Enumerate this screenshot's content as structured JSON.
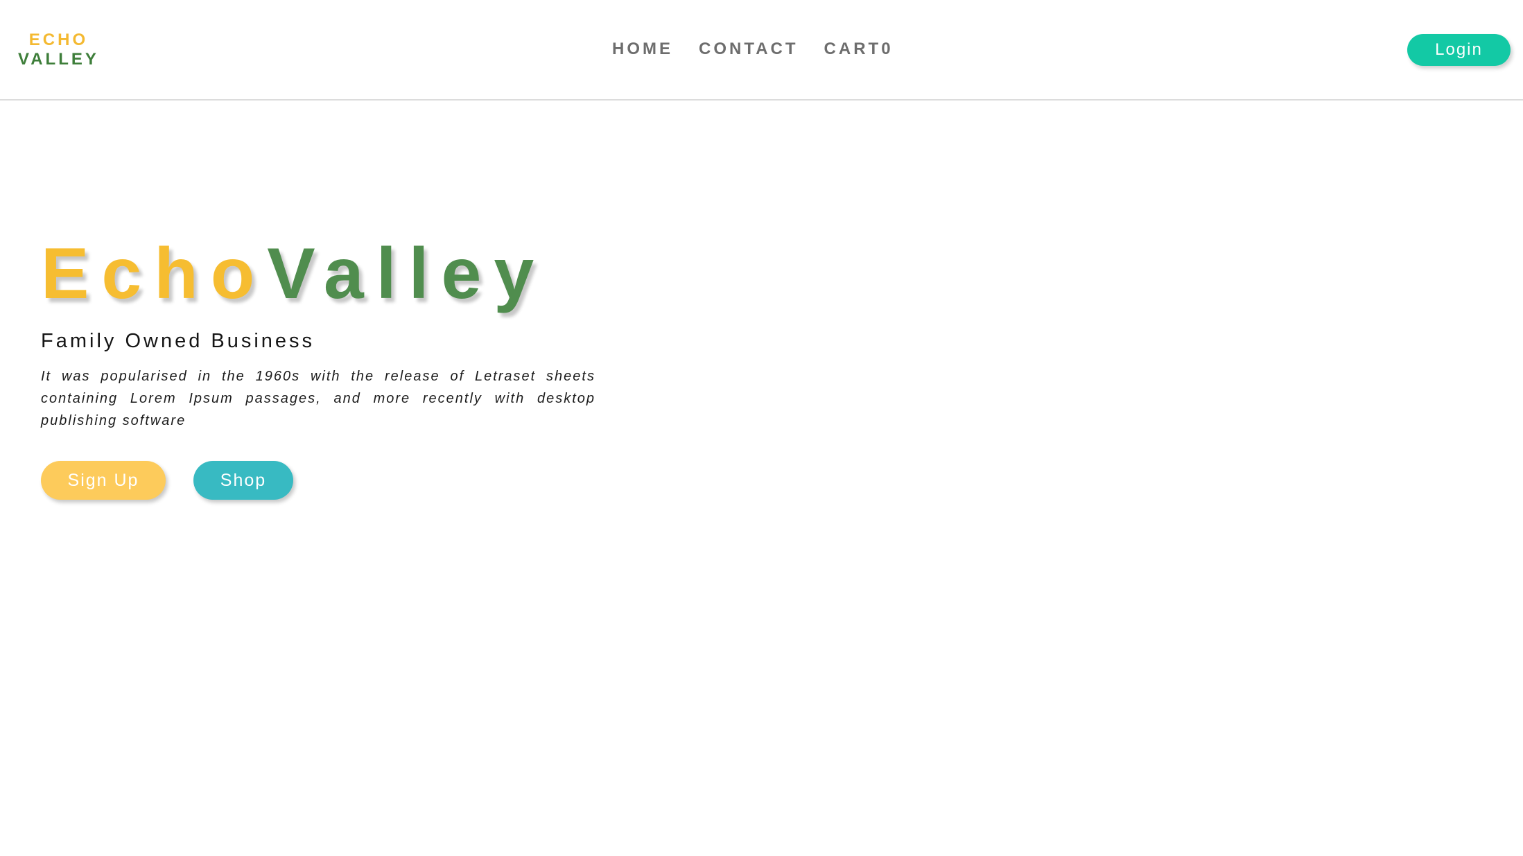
{
  "brand": {
    "line1": "ECHO",
    "line2": "VALLEY",
    "colors": {
      "echo": "#f4b931",
      "valley": "#3e7e3a"
    }
  },
  "nav": {
    "items": [
      {
        "label": "HOME"
      },
      {
        "label": "CONTACT"
      },
      {
        "label": "CART",
        "count": "0"
      }
    ],
    "login_label": "Login"
  },
  "hero": {
    "title_part1": "Echo",
    "title_part2": "Valley",
    "subtitle": "Family Owned Business",
    "text": "It was popularised in the 1960s with the release of Letraset sheets containing Lorem Ipsum passages, and more recently with desktop publishing software",
    "buttons": {
      "signup_label": "Sign Up",
      "shop_label": "Shop"
    }
  },
  "colors": {
    "login_button": "#13c9a5",
    "signup_button": "#fdcb5b",
    "shop_button": "#38bac2",
    "nav_text": "#6d6d6d"
  }
}
